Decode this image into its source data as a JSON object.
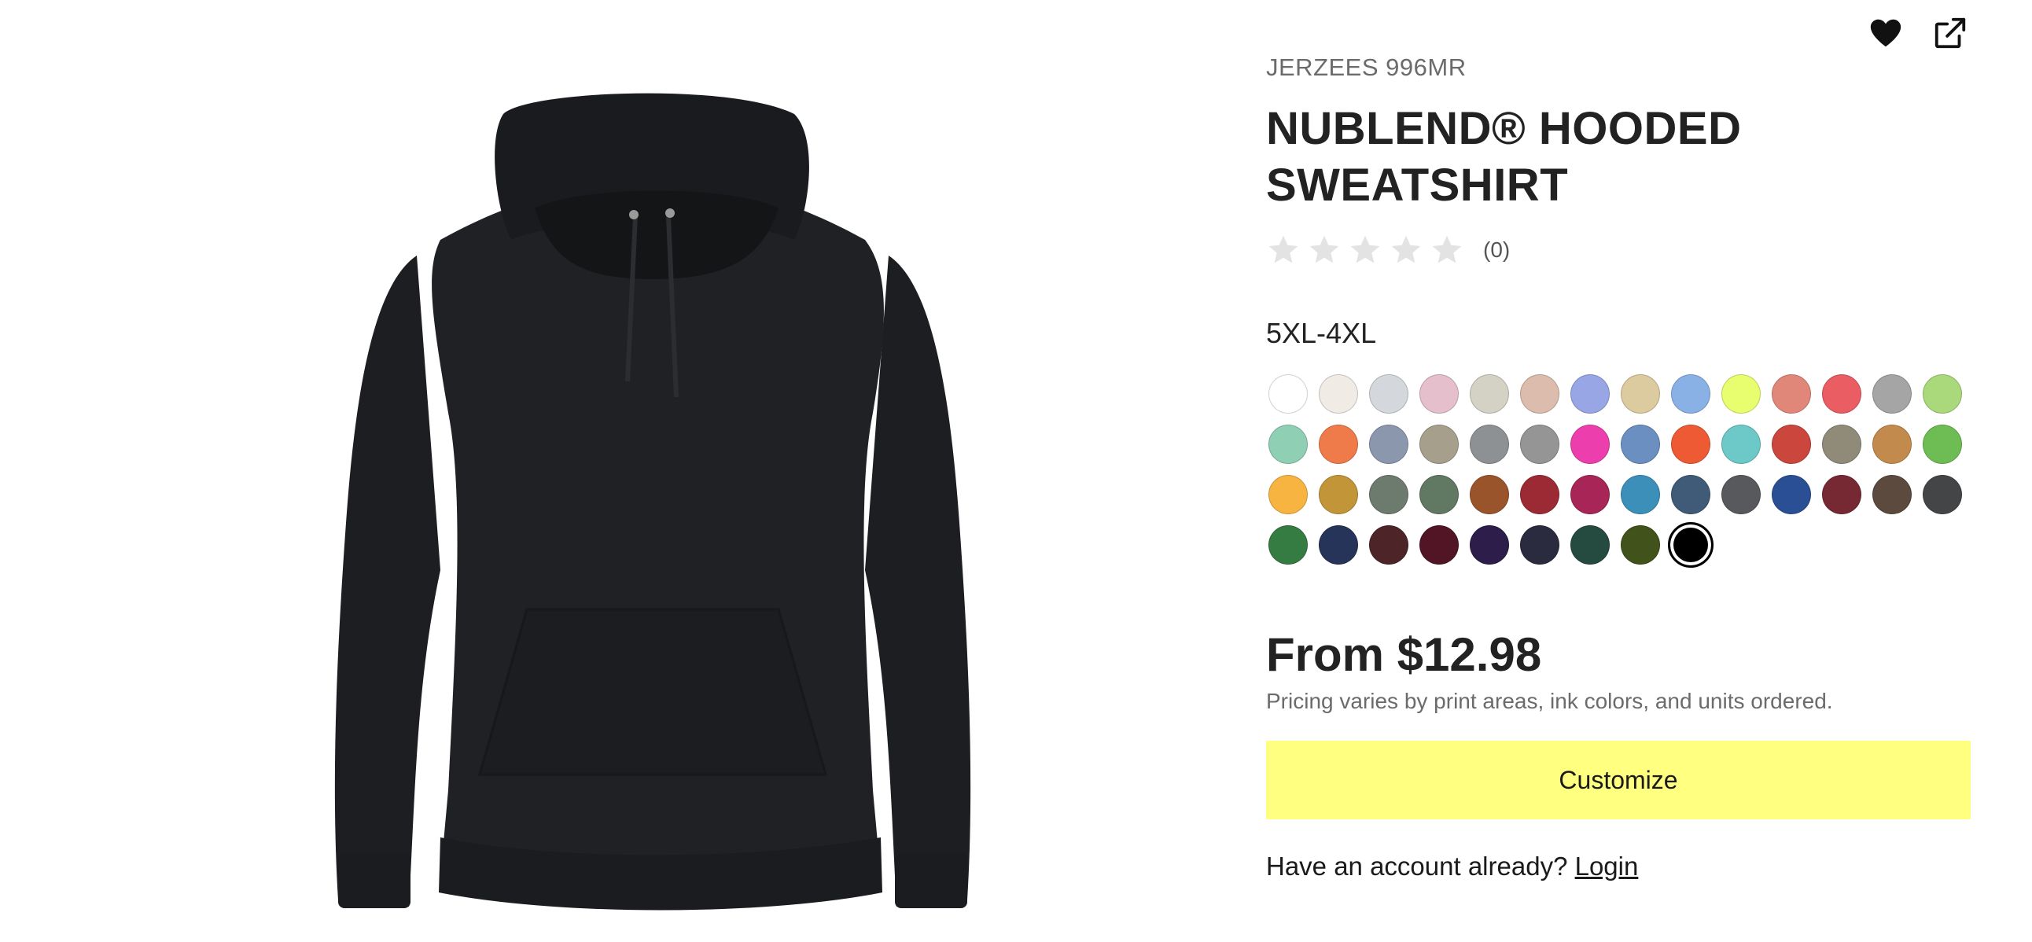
{
  "product": {
    "brand_code": "JERZEES 996MR",
    "title": "NUBLEND® HOODED SWEATSHIRT",
    "rating_count": "(0)",
    "rating_stars": 0,
    "size_range": "5XL-4XL",
    "price": "From $12.98",
    "pricing_note": "Pricing varies by print areas, ink colors, and units ordered."
  },
  "actions": {
    "favorite_icon": "heart-icon",
    "share_icon": "external-link-icon",
    "customize_label": "Customize",
    "account_prompt": "Have an account already?",
    "login_label": "Login"
  },
  "colors": {
    "accent_button": "#ffff80",
    "garment": "#1e1f22",
    "swatches": [
      "#ffffff",
      "#f1ebe6",
      "#d4d8dc",
      "#e6bfcd",
      "#d4d2c4",
      "#dbbcad",
      "#98a6e6",
      "#dccb9f",
      "#8ab1e6",
      "#e8fe6e",
      "#e1877a",
      "#ea5d63",
      "#a5a5a5",
      "#a9d97a",
      "#8fd0b5",
      "#ef7b4a",
      "#8b97ac",
      "#a69f8b",
      "#8e9193",
      "#959595",
      "#ec3fad",
      "#6a8fc0",
      "#ee5a34",
      "#6cc9c8",
      "#cb463c",
      "#908a79",
      "#c38a4d",
      "#6ebd54",
      "#f7b440",
      "#c29539",
      "#6d7b6e",
      "#617862",
      "#9a542c",
      "#9b2a34",
      "#a82557",
      "#3c8fb9",
      "#3f5b78",
      "#57595c",
      "#2b4f94",
      "#762933",
      "#5b4a3d",
      "#444546",
      "#357c42",
      "#263459",
      "#4d2529",
      "#511525",
      "#2c1d4a",
      "#2a2b3f",
      "#254a40",
      "#41521a",
      "#000000"
    ],
    "selected_index": 50
  }
}
